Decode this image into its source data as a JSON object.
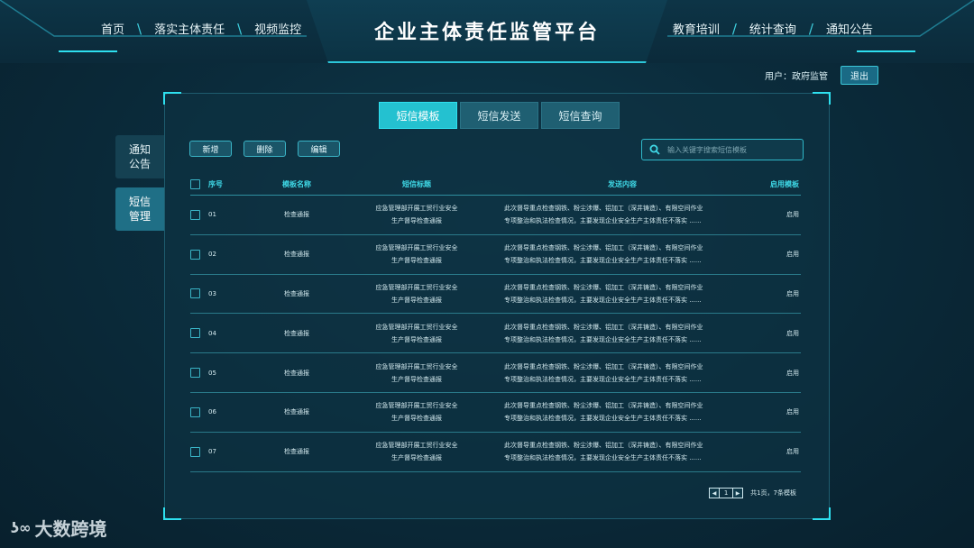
{
  "header": {
    "title": "企业主体责任监管平台",
    "nav_left": [
      "首页",
      "落实主体责任",
      "视频监控"
    ],
    "nav_right": [
      "教育培训",
      "统计查询",
      "通知公告"
    ],
    "separator": "\\",
    "separator_right": "/"
  },
  "user": {
    "label": "用户：政府监管",
    "logout": "退出"
  },
  "side_tabs": [
    {
      "label": "通知公告",
      "active": false
    },
    {
      "label": "短信管理",
      "active": true
    }
  ],
  "tabs": [
    {
      "label": "短信模板",
      "active": true
    },
    {
      "label": "短信发送",
      "active": false
    },
    {
      "label": "短信查询",
      "active": false
    }
  ],
  "actions": {
    "add": "新增",
    "delete": "删除",
    "edit": "编辑"
  },
  "search": {
    "placeholder": "输入关键字搜索短信模板",
    "icon": "search-icon"
  },
  "table": {
    "headers": {
      "no": "序号",
      "name": "模板名称",
      "title": "短信标题",
      "content": "发送内容",
      "enable": "启用模板"
    },
    "rows": [
      {
        "no": "01",
        "name": "检查通报",
        "title_l1": "应急管理部开展工贸行业安全",
        "title_l2": "生产督导检查通报",
        "content_l1": "此次督导重点检查钢铁、粉尘涉爆、铝加工（深井铸造）、有限空间作业",
        "content_l2": "专项整治和执法检查情况，主要发现企业安全生产主体责任不落实 ......",
        "enable": "启用"
      },
      {
        "no": "02",
        "name": "检查通报",
        "title_l1": "应急管理部开展工贸行业安全",
        "title_l2": "生产督导检查通报",
        "content_l1": "此次督导重点检查钢铁、粉尘涉爆、铝加工（深井铸造）、有限空间作业",
        "content_l2": "专项整治和执法检查情况，主要发现企业安全生产主体责任不落实 ......",
        "enable": "启用"
      },
      {
        "no": "03",
        "name": "检查通报",
        "title_l1": "应急管理部开展工贸行业安全",
        "title_l2": "生产督导检查通报",
        "content_l1": "此次督导重点检查钢铁、粉尘涉爆、铝加工（深井铸造）、有限空间作业",
        "content_l2": "专项整治和执法检查情况，主要发现企业安全生产主体责任不落实 ......",
        "enable": "启用"
      },
      {
        "no": "04",
        "name": "检查通报",
        "title_l1": "应急管理部开展工贸行业安全",
        "title_l2": "生产督导检查通报",
        "content_l1": "此次督导重点检查钢铁、粉尘涉爆、铝加工（深井铸造）、有限空间作业",
        "content_l2": "专项整治和执法检查情况，主要发现企业安全生产主体责任不落实 ......",
        "enable": "启用"
      },
      {
        "no": "05",
        "name": "检查通报",
        "title_l1": "应急管理部开展工贸行业安全",
        "title_l2": "生产督导检查通报",
        "content_l1": "此次督导重点检查钢铁、粉尘涉爆、铝加工（深井铸造）、有限空间作业",
        "content_l2": "专项整治和执法检查情况，主要发现企业安全生产主体责任不落实 ......",
        "enable": "启用"
      },
      {
        "no": "06",
        "name": "检查通报",
        "title_l1": "应急管理部开展工贸行业安全",
        "title_l2": "生产督导检查通报",
        "content_l1": "此次督导重点检查钢铁、粉尘涉爆、铝加工（深井铸造）、有限空间作业",
        "content_l2": "专项整治和执法检查情况，主要发现企业安全生产主体责任不落实 ......",
        "enable": "启用"
      },
      {
        "no": "07",
        "name": "检查通报",
        "title_l1": "应急管理部开展工贸行业安全",
        "title_l2": "生产督导检查通报",
        "content_l1": "此次督导重点检查钢铁、粉尘涉爆、铝加工（深井铸造）、有限空间作业",
        "content_l2": "专项整治和执法检查情况，主要发现企业安全生产主体责任不落实 ......",
        "enable": "启用"
      }
    ]
  },
  "pagination": {
    "prev": "◀",
    "page": "1",
    "next": "▶",
    "info": "共1页，7条模板"
  },
  "watermark": {
    "text": "大数跨境"
  },
  "colors": {
    "accent": "#24c1d0",
    "background": "#0b2c3c",
    "panel": "#0d3242"
  }
}
